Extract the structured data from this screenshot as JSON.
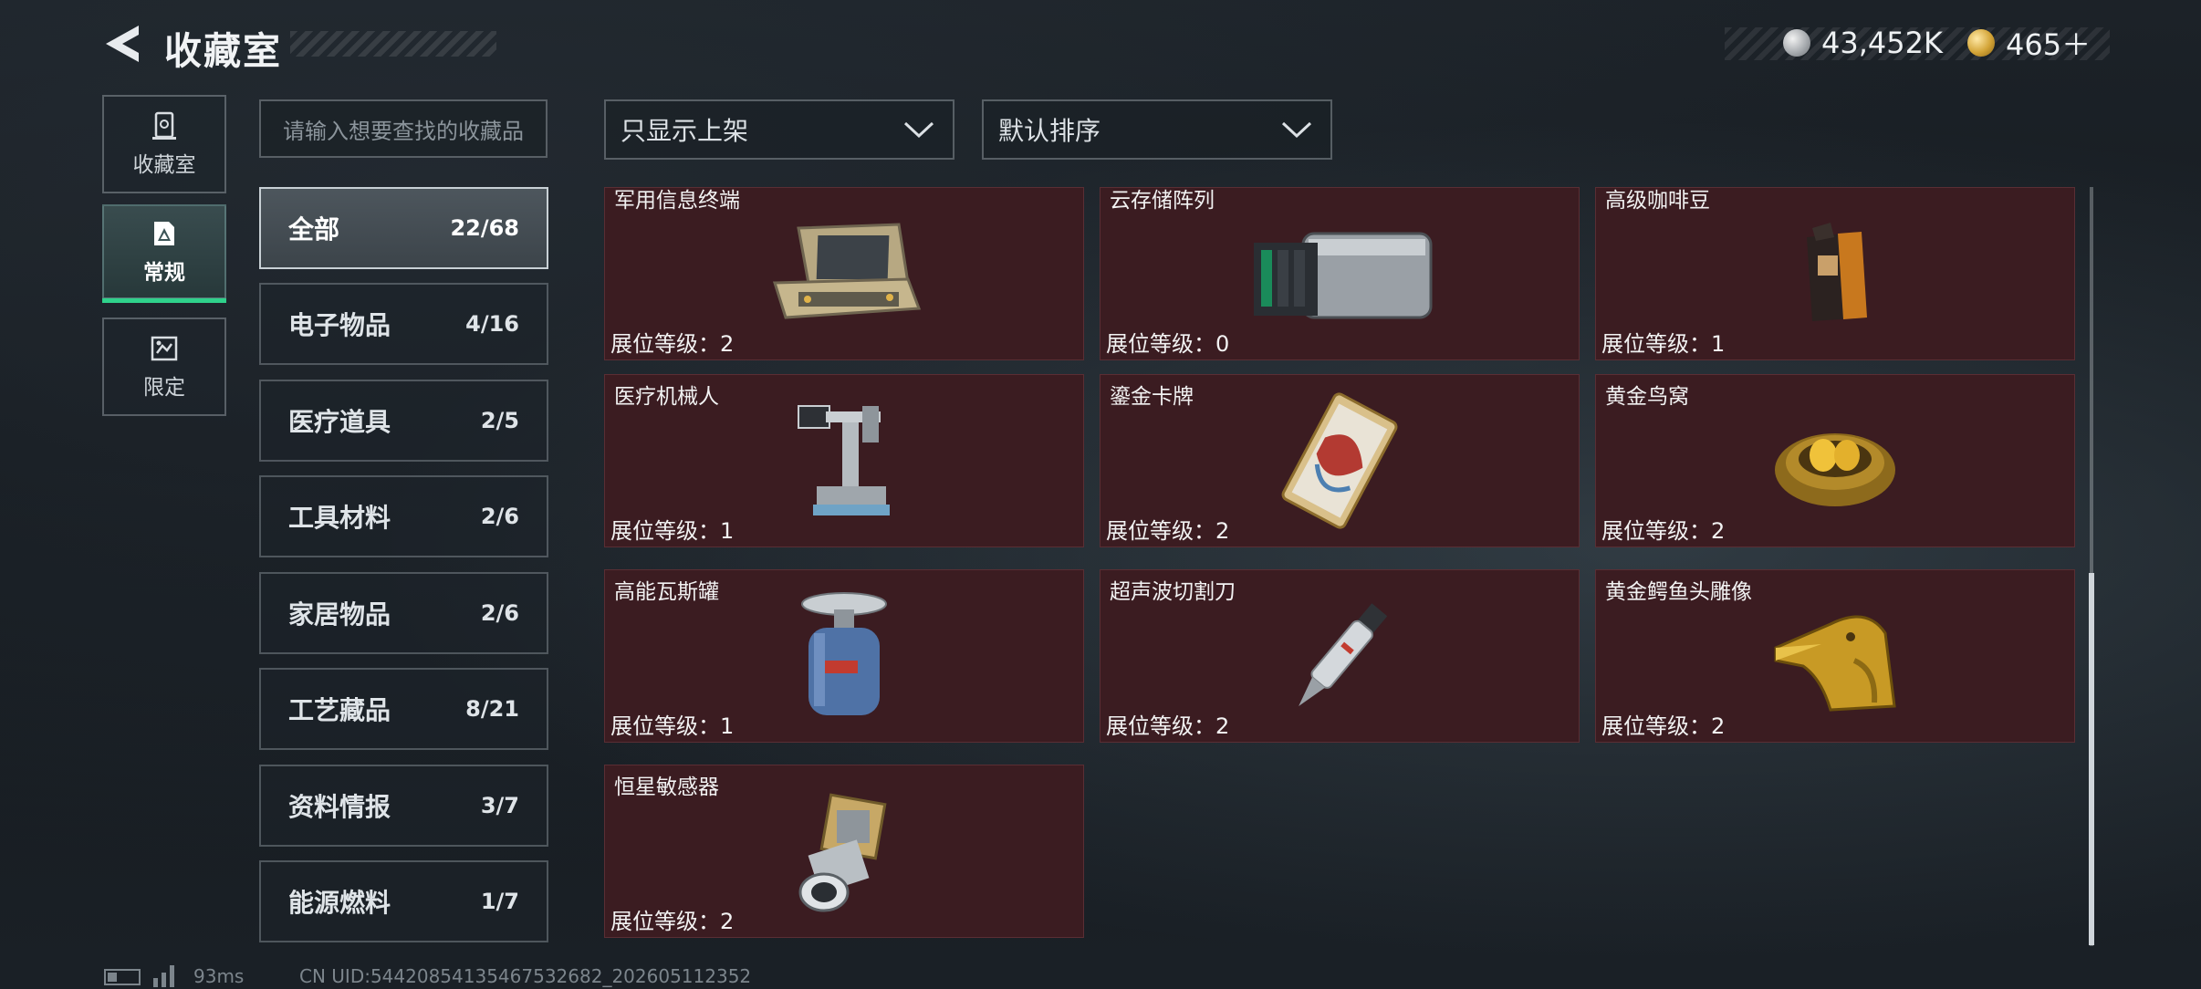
{
  "header": {
    "title": "收藏室",
    "currency": [
      {
        "icon": "silver-coin-icon",
        "value": "43,452K"
      },
      {
        "icon": "gold-coin-icon",
        "value": "465＋"
      }
    ]
  },
  "nav": [
    {
      "label": "收藏室",
      "icon": "collection-room-icon",
      "active": false
    },
    {
      "label": "常规",
      "icon": "regular-card-icon",
      "active": true
    },
    {
      "label": "限定",
      "icon": "limited-card-icon",
      "active": false
    }
  ],
  "search": {
    "placeholder": "请输入想要查找的收藏品"
  },
  "categories": [
    {
      "name": "全部",
      "count": "22/68"
    },
    {
      "name": "电子物品",
      "count": "4/16"
    },
    {
      "name": "医疗道具",
      "count": "2/5"
    },
    {
      "name": "工具材料",
      "count": "2/6"
    },
    {
      "name": "家居物品",
      "count": "2/6"
    },
    {
      "name": "工艺藏品",
      "count": "8/21"
    },
    {
      "name": "资料情报",
      "count": "3/7"
    },
    {
      "name": "能源燃料",
      "count": "1/7"
    }
  ],
  "filters": {
    "shelf": "只显示上架",
    "sort": "默认排序"
  },
  "items": [
    {
      "name": "军用信息终端",
      "level": "展位等级：2"
    },
    {
      "name": "云存储阵列",
      "level": "展位等级：0"
    },
    {
      "name": "高级咖啡豆",
      "level": "展位等级：1"
    },
    {
      "name": "医疗机械人",
      "level": "展位等级：1"
    },
    {
      "name": "鎏金卡牌",
      "level": "展位等级：2"
    },
    {
      "name": "黄金鸟窝",
      "level": "展位等级：2"
    },
    {
      "name": "高能瓦斯罐",
      "level": "展位等级：1"
    },
    {
      "name": "超声波切割刀",
      "level": "展位等级：2"
    },
    {
      "name": "黄金鳄鱼头雕像",
      "level": "展位等级：2"
    },
    {
      "name": "恒星敏感器",
      "level": "展位等级：2"
    }
  ],
  "footer": {
    "ping": "93ms",
    "uid": "CN UID:54420854135467532682_202605112352"
  },
  "colors": {
    "card_bg": "#3b1c21",
    "active_accent": "#2fd28b"
  }
}
